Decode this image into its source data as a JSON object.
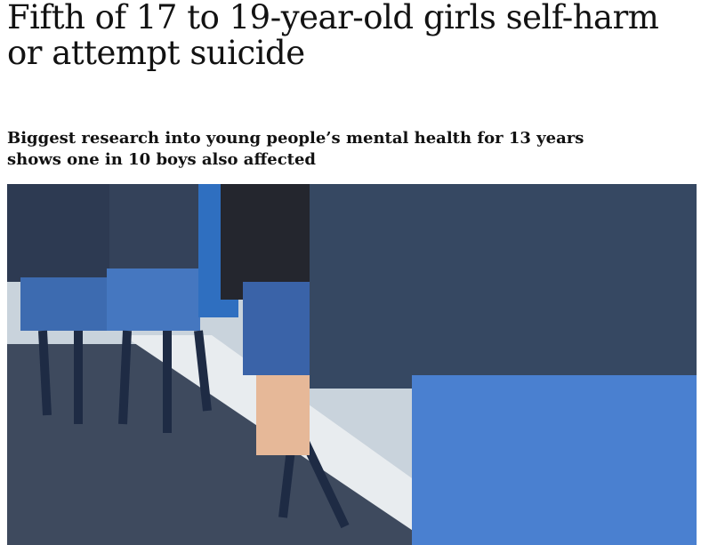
{
  "article": {
    "headline": "Fifth of 17 to 19-year-old girls self-harm or attempt suicide",
    "standfirst": "Biggest research into young people’s mental health for 13 years shows one in 10 boys also affected"
  }
}
